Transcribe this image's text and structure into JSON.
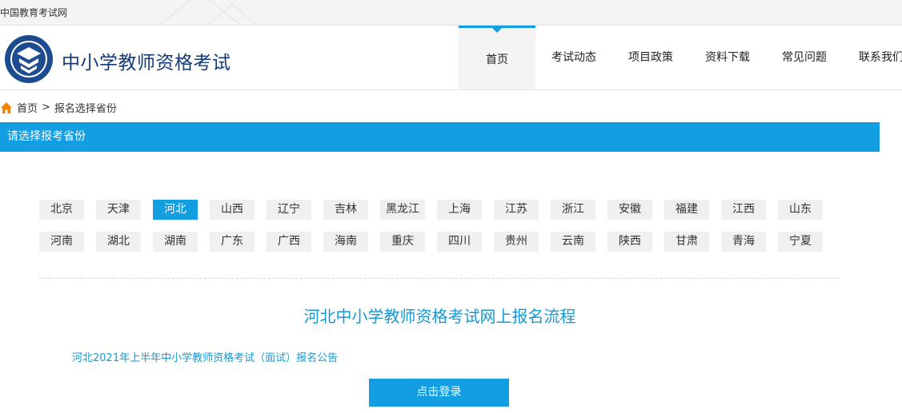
{
  "topbar": {
    "site_name": "中国教育考试网"
  },
  "header": {
    "title": "中小学教师资格考试",
    "nav": [
      {
        "label": "首页",
        "active": true
      },
      {
        "label": "考试动态"
      },
      {
        "label": "项目政策"
      },
      {
        "label": "资料下载"
      },
      {
        "label": "常见问题"
      },
      {
        "label": "联系我们"
      }
    ]
  },
  "breadcrumb": {
    "home": "首页",
    "separator": ">",
    "current": "报名选择省份"
  },
  "section": {
    "title": "请选择报考省份"
  },
  "provinces": {
    "selected": "河北",
    "row1": [
      "北京",
      "天津",
      "河北",
      "山西",
      "辽宁",
      "吉林",
      "黑龙江",
      "上海",
      "江苏",
      "浙江",
      "安徽",
      "福建",
      "江西",
      "山东"
    ],
    "row2": [
      "河南",
      "湖北",
      "湖南",
      "广东",
      "广西",
      "海南",
      "重庆",
      "四川",
      "贵州",
      "云南",
      "陕西",
      "甘肃",
      "青海",
      "宁夏"
    ]
  },
  "content": {
    "flow_title": "河北中小学教师资格考试网上报名流程",
    "notice_link": "河北2021年上半年中小学教师资格考试（面试）报名公告",
    "login_button": "点击登录"
  },
  "colors": {
    "accent": "#129ee0",
    "link": "#1699d3",
    "title": "#133a78"
  }
}
